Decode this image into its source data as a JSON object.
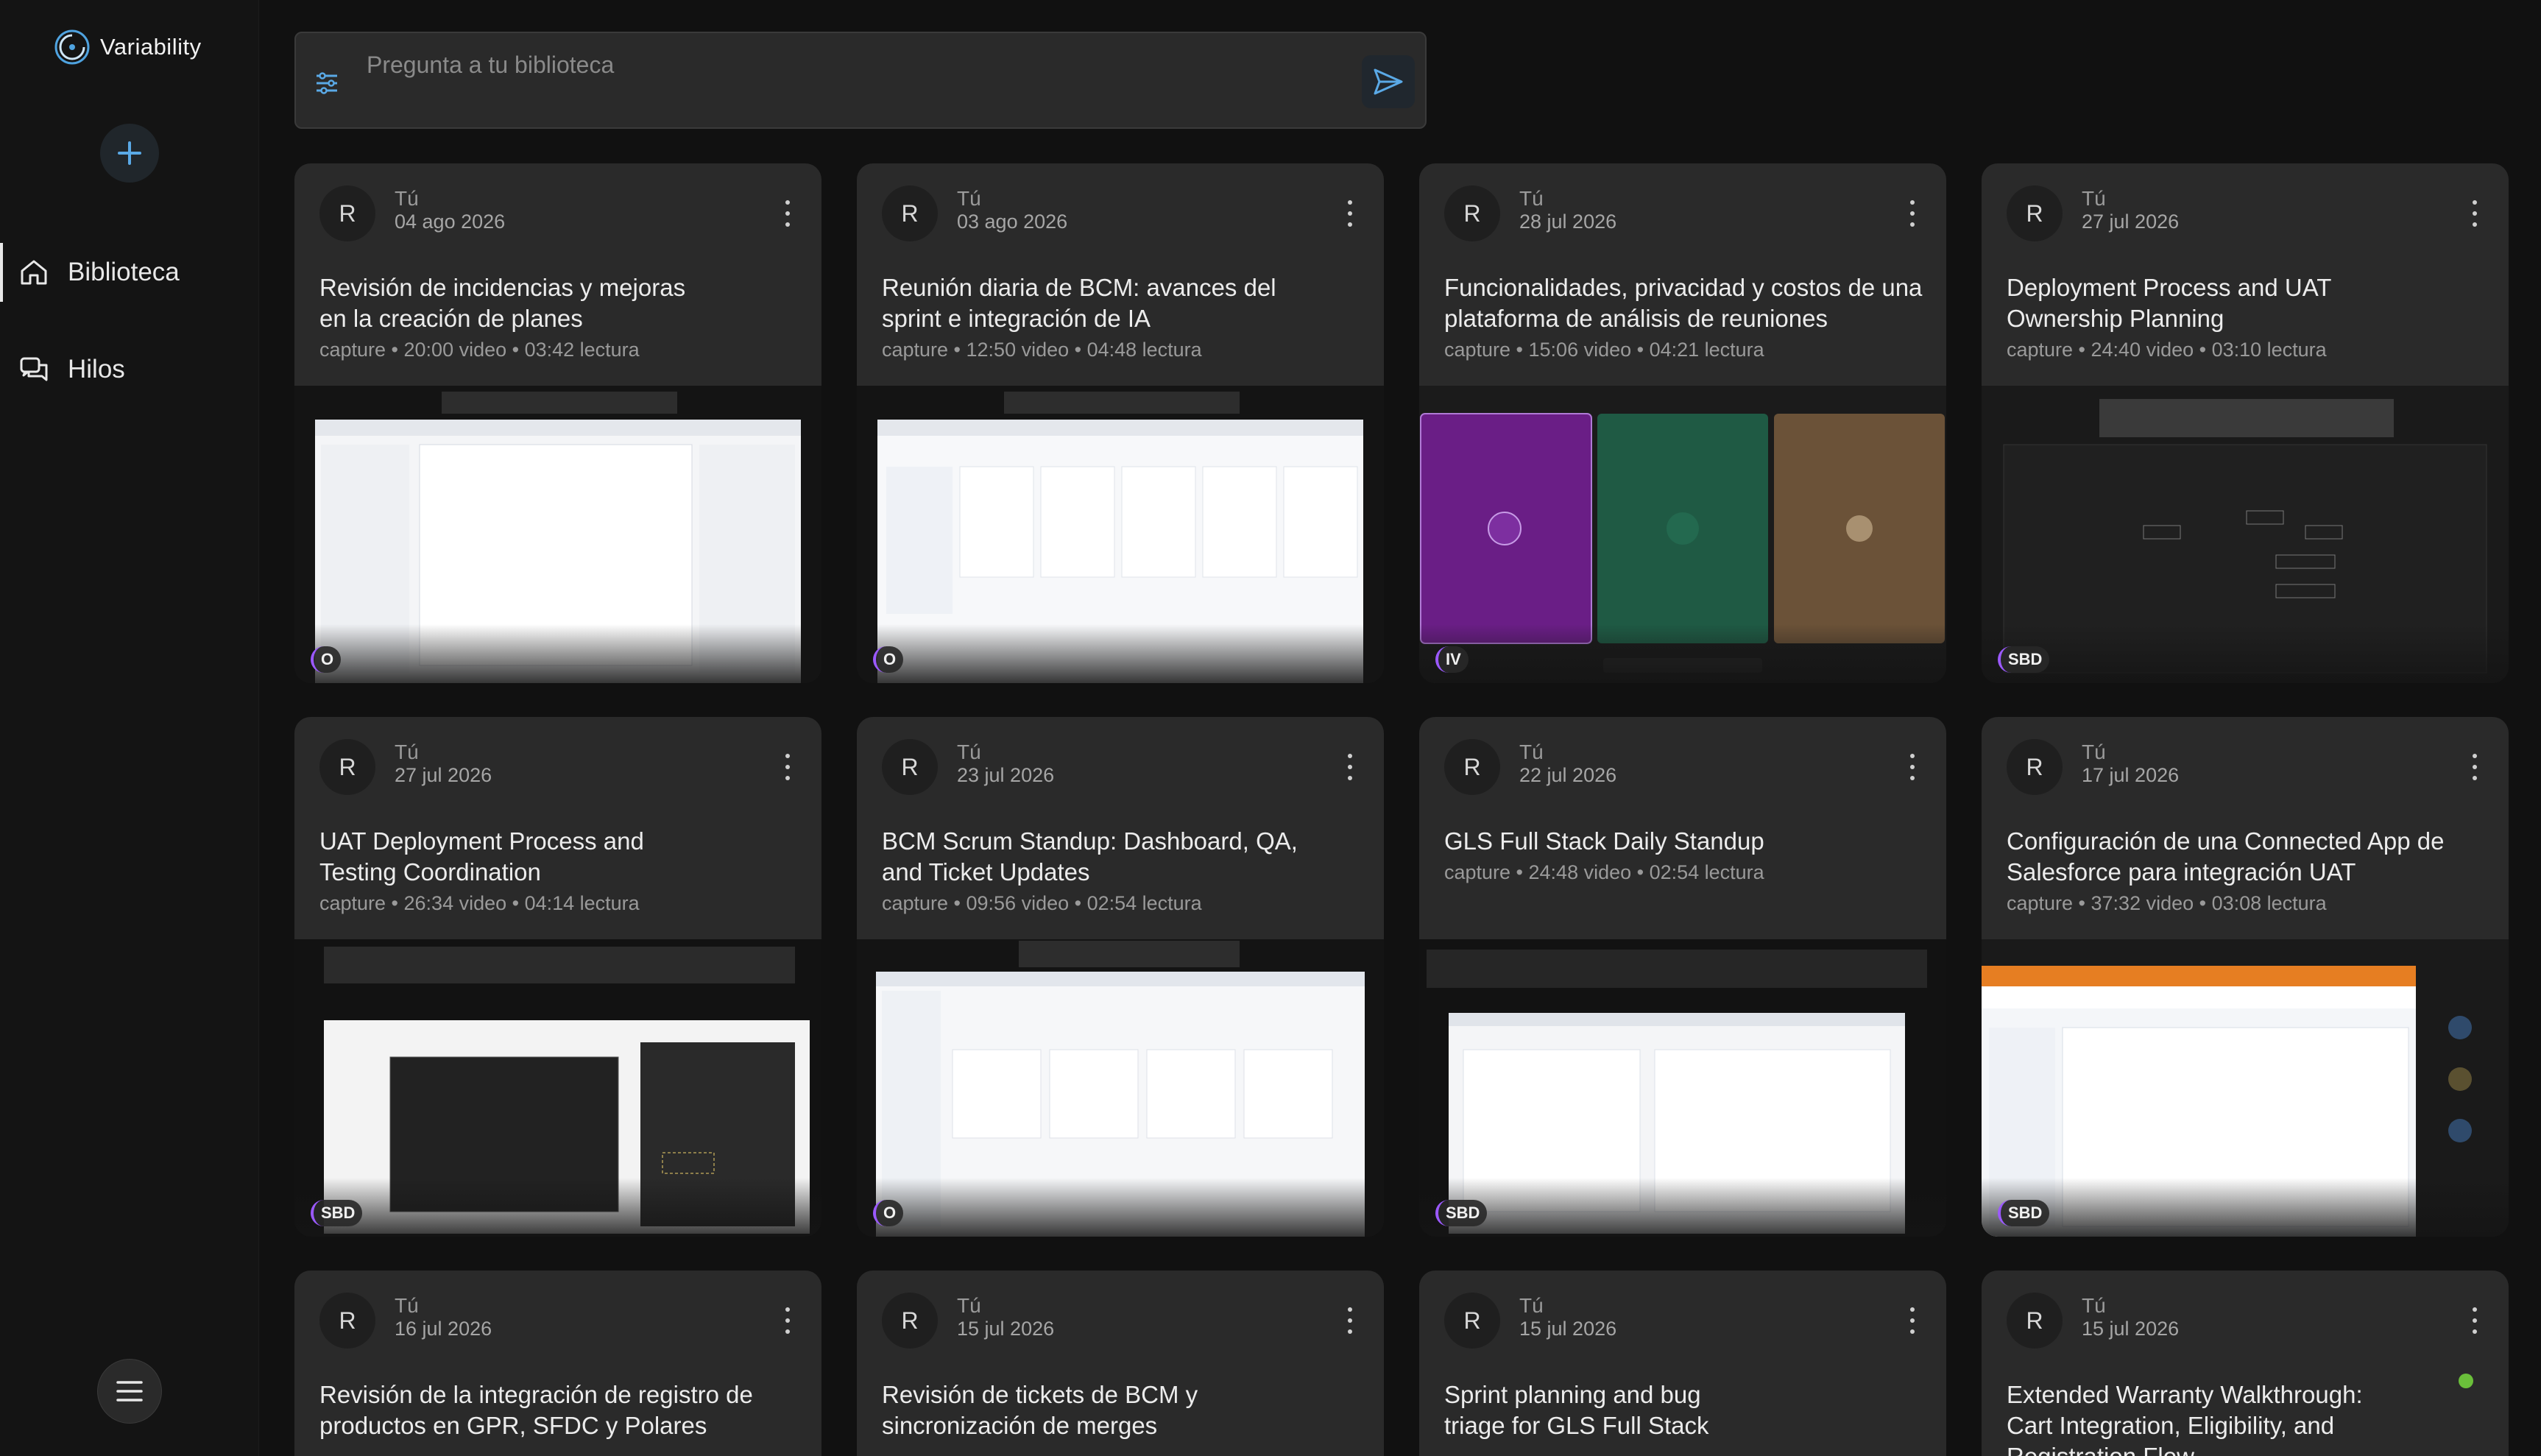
{
  "app": {
    "name": "Variability"
  },
  "sidebar": {
    "items": [
      {
        "label": "Biblioteca",
        "icon": "home-icon",
        "active": true
      },
      {
        "label": "Hilos",
        "icon": "threads-icon",
        "active": false
      }
    ]
  },
  "search": {
    "placeholder": "Pregunta a tu biblioteca",
    "value": ""
  },
  "colors": {
    "accent": "#5aa9e6",
    "badge_ring": "#9b59ff",
    "status_green": "#6abf3a"
  },
  "cards": [
    {
      "avatar": "R",
      "owner": "Tú",
      "date": "04 ago 2026",
      "title": "Revisión de incidencias y mejoras en la creación de planes",
      "meta": "capture • 20:00 video • 03:42 lectura",
      "badge": "O"
    },
    {
      "avatar": "R",
      "owner": "Tú",
      "date": "03 ago 2026",
      "title": "Reunión diaria de BCM: avances del sprint e integración de IA",
      "meta": "capture • 12:50 video • 04:48 lectura",
      "badge": "O"
    },
    {
      "avatar": "R",
      "owner": "Tú",
      "date": "28 jul 2026",
      "title": "Funcionalidades, privacidad y costos de una plataforma de análisis de reuniones",
      "meta": "capture • 15:06 video • 04:21 lectura",
      "badge": "IV"
    },
    {
      "avatar": "R",
      "owner": "Tú",
      "date": "27 jul 2026",
      "title": "Deployment Process and UAT Ownership Planning",
      "meta": "capture • 24:40 video • 03:10 lectura",
      "badge": "SBD"
    },
    {
      "avatar": "R",
      "owner": "Tú",
      "date": "27 jul 2026",
      "title": "UAT Deployment Process and Testing Coordination",
      "meta": "capture • 26:34 video • 04:14 lectura",
      "badge": "SBD"
    },
    {
      "avatar": "R",
      "owner": "Tú",
      "date": "23 jul 2026",
      "title": "BCM Scrum Standup: Dashboard, QA, and Ticket Updates",
      "meta": "capture • 09:56 video • 02:54 lectura",
      "badge": "O"
    },
    {
      "avatar": "R",
      "owner": "Tú",
      "date": "22 jul 2026",
      "title": "GLS Full Stack Daily Standup",
      "meta": "capture • 24:48 video • 02:54 lectura",
      "badge": "SBD"
    },
    {
      "avatar": "R",
      "owner": "Tú",
      "date": "17 jul 2026",
      "title": "Configuración de una Connected App de Salesforce para integración UAT",
      "meta": "capture • 37:32 video • 03:08 lectura",
      "badge": "SBD"
    },
    {
      "avatar": "R",
      "owner": "Tú",
      "date": "16 jul 2026",
      "title": "Revisión de la integración de registro de productos en GPR, SFDC y Polares",
      "meta": "",
      "badge": ""
    },
    {
      "avatar": "R",
      "owner": "Tú",
      "date": "15 jul 2026",
      "title": "Revisión de tickets de BCM y sincronización de merges",
      "meta": "",
      "badge": ""
    },
    {
      "avatar": "R",
      "owner": "Tú",
      "date": "15 jul 2026",
      "title": "Sprint planning and bug triage for GLS Full Stack",
      "meta": "",
      "badge": ""
    },
    {
      "avatar": "R",
      "owner": "Tú",
      "date": "15 jul 2026",
      "title": "Extended Warranty Walkthrough: Cart Integration, Eligibility, and Registration Flow",
      "meta": "",
      "badge": ""
    }
  ]
}
